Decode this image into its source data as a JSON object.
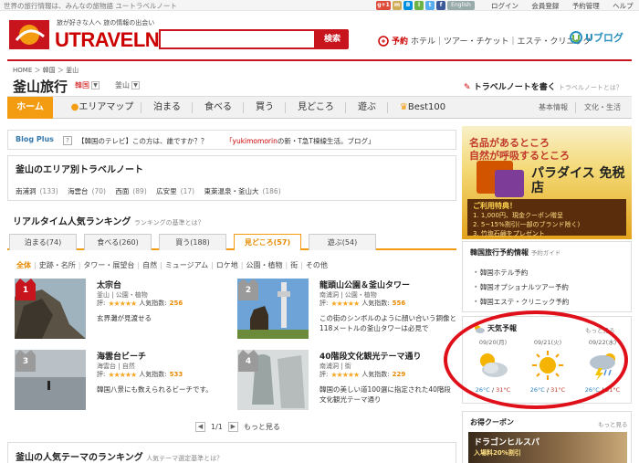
{
  "topbar": {
    "tagline": "世界の旅行情報は、みんなの旅物語 ユートラベルノート",
    "sns": [
      {
        "name": "google-plus-icon",
        "label": "g+1",
        "color": "#dd4b39"
      },
      {
        "name": "mixi-icon",
        "label": "m",
        "color": "#d1ad59"
      },
      {
        "name": "hatena-icon",
        "label": "B",
        "color": "#008fde"
      },
      {
        "name": "livedoor-icon",
        "label": "l",
        "color": "#6ab344"
      },
      {
        "name": "twitter-icon",
        "label": "t",
        "color": "#55acee"
      },
      {
        "name": "facebook-icon",
        "label": "f",
        "color": "#3b5998"
      }
    ],
    "english": "English",
    "links": [
      "ログイン",
      "会員登録",
      "予約管理",
      "ヘルプ"
    ]
  },
  "header": {
    "catch": "旅が好きな人へ 旅の情報の出会い",
    "brand": "UTRAVELNOTE",
    "search_button": "検索",
    "yoyaku": "予約",
    "nav_links": "ホテル｜ツアー・チケット｜エステ・クリニック",
    "ublog": "Uブログ"
  },
  "breadcrumb": "HOME ＞ 韓国 ＞ 釜山",
  "page": {
    "title": "釜山旅行",
    "country": "韓国",
    "city": "釜山",
    "write_note": "トラベルノートを書く",
    "write_note_sub": "トラベルノートとは？"
  },
  "nav": {
    "items": [
      "ホーム",
      "エリアマップ",
      "泊まる",
      "食べる",
      "買う",
      "見どころ",
      "遊ぶ",
      "Best100"
    ],
    "right": [
      "基本情報",
      "文化・生活"
    ]
  },
  "blogplus": {
    "label": "Blog Plus",
    "q": "?",
    "text1": "【韓国のテレビ】この方は、誰ですか？？",
    "text2_hl": "「yukimomorin",
    "text2": "の新・T急T棟線生活。ブログ」"
  },
  "area": {
    "title": "釜山のエリア別トラベルノート",
    "items": [
      {
        "name": "南浦洞",
        "count": "(133)"
      },
      {
        "name": "海雲台",
        "count": "(70)"
      },
      {
        "name": "西面",
        "count": "(89)"
      },
      {
        "name": "広安里",
        "count": "(17)"
      },
      {
        "name": "東萊温泉・釜山大",
        "count": "(186)"
      }
    ]
  },
  "ranking": {
    "title": "リアルタイム人気ランキング",
    "title_sub": "ランキングの基準とは？",
    "tabs": [
      "泊まる(74)",
      "食べる(260)",
      "買う(188)",
      "見どころ(57)",
      "遊ぶ(54)"
    ],
    "subcats": [
      "全体",
      "史跡・名所",
      "タワー・展望台",
      "自然",
      "ミュージアム",
      "ロケ地",
      "公園・植物",
      "街",
      "その他"
    ],
    "score_label": "人気指数:",
    "rating_label": "評:",
    "items": [
      {
        "rank": "1",
        "name": "太宗台",
        "meta": "釜山 | 公園・植物",
        "stars": "★★★★★",
        "score": "256",
        "desc": "玄界灘が見渡せる"
      },
      {
        "rank": "2",
        "name": "龍頭山公園＆釜山タワー",
        "meta": "南浦洞 | 公園・植物",
        "stars": "★★★★★",
        "score": "556",
        "desc": "この街のシンボルのように顔い合いう銅像と118メートルの釜山タワーは必見で"
      },
      {
        "rank": "3",
        "name": "海雲台ビーチ",
        "meta": "海雲台 | 自然",
        "stars": "★★★★★",
        "score": "533",
        "desc": "韓国八景にも数えられるビーチです。"
      },
      {
        "rank": "4",
        "name": "40階段文化観光テーマ通り",
        "meta": "南浦洞 | 街",
        "stars": "★★★★★",
        "score": "229",
        "desc": "韓国の美しい道100選に指定された40階段文化観光テーマ通り"
      }
    ],
    "pager": "1/1",
    "more": "もっと見る"
  },
  "theme": {
    "title": "釜山の人気テーマのランキング",
    "sub": "人気テーマ選定基準とは？"
  },
  "ad": {
    "line1": "名品があるところ",
    "line2": "自然が呼吸するところ",
    "shop": "パラダイス 免税店",
    "use_title": "ご利用特典！",
    "use1": "1. 1,000円、現金クーポン贈呈",
    "use2": "2. 5~15%割引(一部のブランド除く)",
    "use3": "3. 竹塩石鹸をプレゼント"
  },
  "reserve": {
    "title": "韓国旅行予約情報",
    "sub": "予約ガイド",
    "links": [
      "韓国ホテル予約",
      "韓国オプショナルツアー予約",
      "韓国エステ・クリニック予約"
    ]
  },
  "weather": {
    "title": "天気予報",
    "more": "もっと見る",
    "days": [
      {
        "date": "09/20(月)",
        "icon": "cloudy-sun-icon",
        "lo": "26°C",
        "hi": "31°C"
      },
      {
        "date": "09/21(火)",
        "icon": "sunny-icon",
        "lo": "26°C",
        "hi": "31°C"
      },
      {
        "date": "09/22(水)",
        "icon": "thunderstorm-icon",
        "lo": "26°C",
        "hi": "31°C"
      }
    ]
  },
  "coupon": {
    "title": "お得クーポン",
    "more": "もっと見る",
    "img_title": "ドラゴンヒルスパ",
    "img_sub": "入場料20%割引"
  }
}
